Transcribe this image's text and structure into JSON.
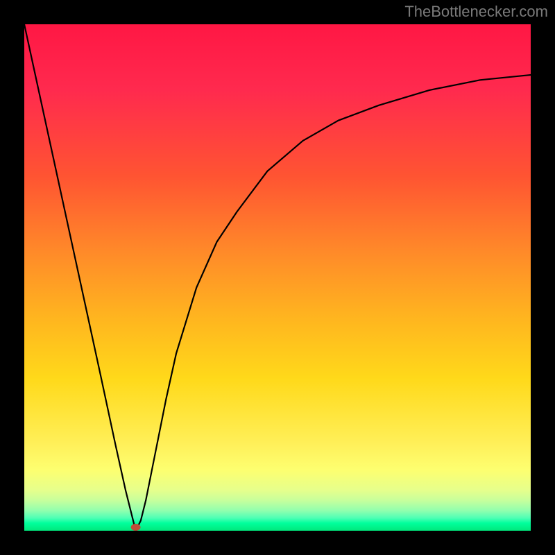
{
  "attribution": "TheBottlenecker.com",
  "chart_data": {
    "type": "line",
    "title": "",
    "xlabel": "",
    "ylabel": "",
    "xlim": [
      0,
      100
    ],
    "ylim": [
      0,
      100
    ],
    "gradient_axis": "y",
    "gradient": [
      "#ff1744",
      "#ffd91a",
      "#00e87c"
    ],
    "minimum_marker": {
      "x": 22,
      "y": 0,
      "color": "#bf4d38"
    },
    "series": [
      {
        "name": "bottleneck-curve",
        "x": [
          0,
          5,
          10,
          15,
          18,
          20,
          21,
          22,
          23,
          24,
          26,
          28,
          30,
          34,
          38,
          42,
          48,
          55,
          62,
          70,
          80,
          90,
          100
        ],
        "y": [
          100,
          77,
          54,
          31,
          17,
          8,
          4,
          0,
          2,
          6,
          16,
          26,
          35,
          48,
          57,
          63,
          71,
          77,
          81,
          84,
          87,
          89,
          90
        ]
      }
    ]
  }
}
